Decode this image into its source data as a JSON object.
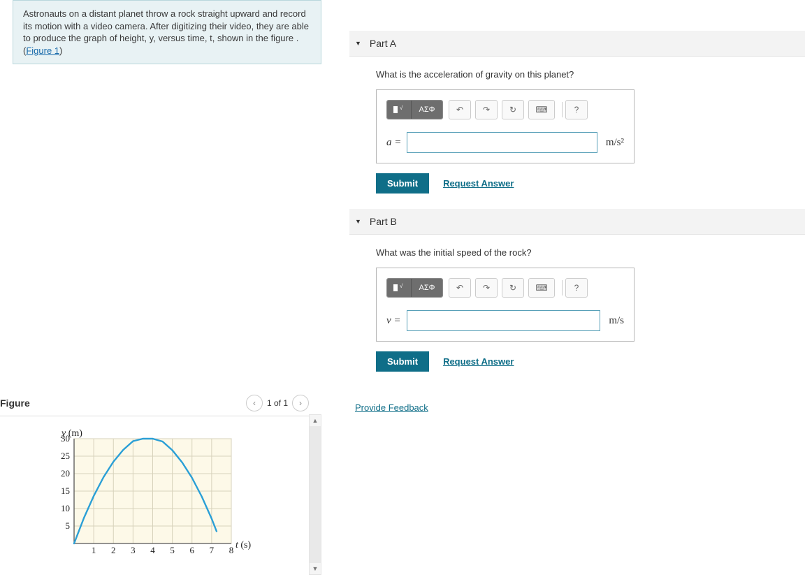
{
  "problem_statement": "Astronauts on a distant planet throw a rock straight upward and record its motion with a video camera. After digitizing their video, they are able to produce the graph of height, y, versus time, t, shown in the figure . (",
  "figure_link_text": "Figure 1",
  "figure_header": {
    "title": "Figure",
    "pager_label": "1 of 1"
  },
  "parts": {
    "a": {
      "title": "Part A",
      "prompt": "What is the acceleration of gravity on this planet?",
      "var": "a =",
      "units_html": "m/s²",
      "submit": "Submit",
      "request": "Request Answer",
      "toolbar_symbols": "ΑΣΦ"
    },
    "b": {
      "title": "Part B",
      "prompt": "What was the initial speed of the rock?",
      "var": "v =",
      "units_html": "m/s",
      "submit": "Submit",
      "request": "Request Answer",
      "toolbar_symbols": "ΑΣΦ"
    }
  },
  "feedback": "Provide Feedback",
  "chart_data": {
    "type": "line",
    "title": "",
    "xlabel": "t (s)",
    "ylabel": "y (m)",
    "x_ticks": [
      1,
      2,
      3,
      4,
      5,
      6,
      7,
      8
    ],
    "y_ticks": [
      5,
      10,
      15,
      20,
      25,
      30
    ],
    "xlim": [
      0,
      8
    ],
    "ylim": [
      0,
      30
    ],
    "x": [
      0,
      0.5,
      1,
      1.5,
      2,
      2.5,
      3,
      3.5,
      4,
      4.5,
      5,
      5.5,
      6,
      6.5,
      7,
      7.25
    ],
    "y": [
      0,
      7.3,
      13.6,
      19.0,
      23.4,
      26.8,
      29.3,
      30.0,
      30.0,
      29.2,
      26.7,
      23.2,
      18.8,
      13.4,
      7.1,
      3.5
    ],
    "annotations": []
  }
}
